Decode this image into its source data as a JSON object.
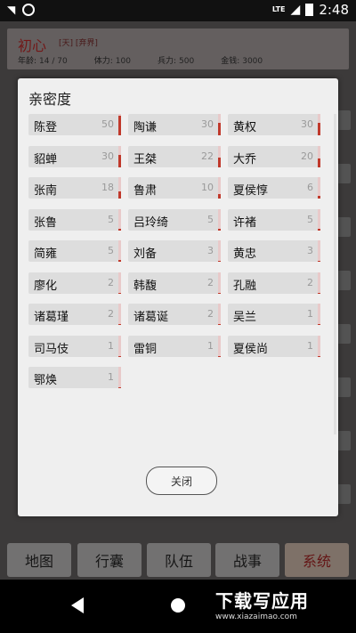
{
  "status_bar": {
    "time": "2:48",
    "network": "LTE"
  },
  "player": {
    "name": "初心",
    "tags": "[天] [弃界]",
    "stats": [
      {
        "label": "年龄:",
        "value": "14 / 70"
      },
      {
        "label": "体力:",
        "value": "100"
      },
      {
        "label": "兵力:",
        "value": "500"
      },
      {
        "label": "金钱:",
        "value": "3000"
      }
    ]
  },
  "modal": {
    "title": "亲密度",
    "close_label": "关闭",
    "rows": [
      [
        {
          "name": "陈登",
          "value": "50",
          "level": 0.9
        },
        {
          "name": "陶谦",
          "value": "30",
          "level": 0.6
        },
        {
          "name": "黄权",
          "value": "30",
          "level": 0.6
        }
      ],
      [
        {
          "name": "貂蝉",
          "value": "30",
          "level": 0.6
        },
        {
          "name": "王桀",
          "value": "22",
          "level": 0.45
        },
        {
          "name": "大乔",
          "value": "20",
          "level": 0.4
        }
      ],
      [
        {
          "name": "张南",
          "value": "18",
          "level": 0.35
        },
        {
          "name": "鲁肃",
          "value": "10",
          "level": 0.2
        },
        {
          "name": "夏侯惇",
          "value": "6",
          "level": 0.12
        }
      ],
      [
        {
          "name": "张鲁",
          "value": "5",
          "level": 0.1
        },
        {
          "name": "吕玲绮",
          "value": "5",
          "level": 0.1
        },
        {
          "name": "许褚",
          "value": "5",
          "level": 0.1
        }
      ],
      [
        {
          "name": "简雍",
          "value": "5",
          "level": 0.1
        },
        {
          "name": "刘备",
          "value": "3",
          "level": 0.06
        },
        {
          "name": "黄忠",
          "value": "3",
          "level": 0.06
        }
      ],
      [
        {
          "name": "廖化",
          "value": "2",
          "level": 0.04
        },
        {
          "name": "韩馥",
          "value": "2",
          "level": 0.04
        },
        {
          "name": "孔融",
          "value": "2",
          "level": 0.04
        }
      ],
      [
        {
          "name": "诸葛瑾",
          "value": "2",
          "level": 0.04
        },
        {
          "name": "诸葛诞",
          "value": "2",
          "level": 0.04
        },
        {
          "name": "吴兰",
          "value": "1",
          "level": 0.02
        }
      ],
      [
        {
          "name": "司马伎",
          "value": "1",
          "level": 0.02
        },
        {
          "name": "雷铜",
          "value": "1",
          "level": 0.02
        },
        {
          "name": "夏侯尚",
          "value": "1",
          "level": 0.02
        }
      ],
      [
        {
          "name": "鄂焕",
          "value": "1",
          "level": 0.02
        }
      ]
    ]
  },
  "bottom_nav": [
    {
      "label": "地图",
      "active": false
    },
    {
      "label": "行囊",
      "active": false
    },
    {
      "label": "队伍",
      "active": false
    },
    {
      "label": "战事",
      "active": false
    },
    {
      "label": "系统",
      "active": true
    }
  ],
  "watermark": {
    "title": "下载写应用",
    "url": "www.xiazaimao.com"
  }
}
